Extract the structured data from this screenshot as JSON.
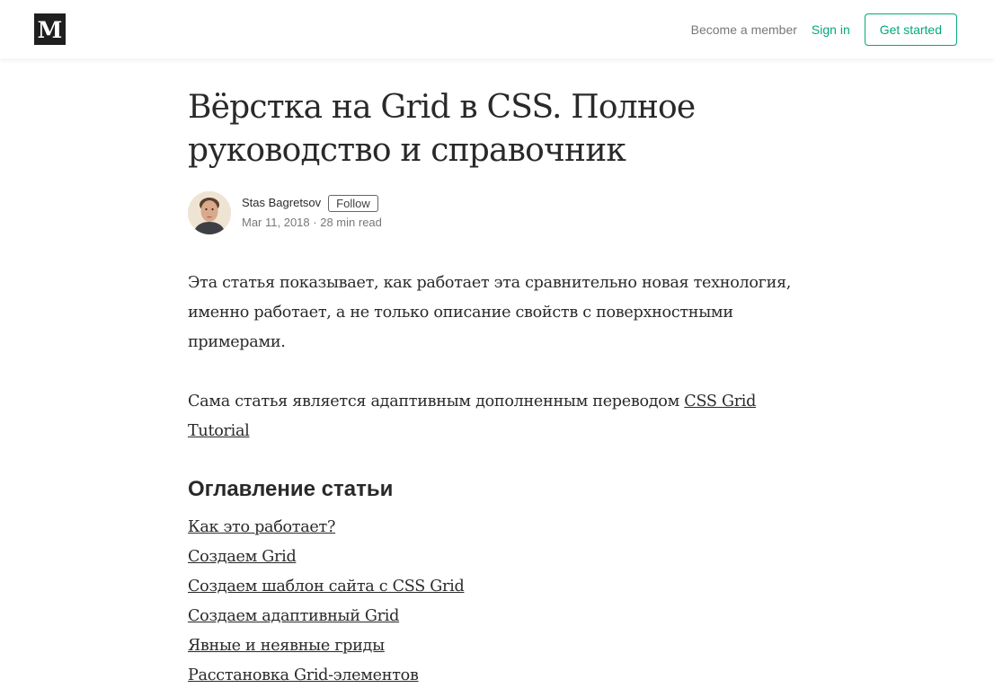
{
  "nav": {
    "logo_letter": "M",
    "logo_icon": "medium-logo-icon",
    "become_member": "Become a member",
    "sign_in": "Sign in",
    "get_started": "Get started",
    "accent_color": "#03a87c"
  },
  "article": {
    "title": "Вёрстка на Grid в CSS. Полное руководство и справочник",
    "author": {
      "name": "Stas Bagretsov",
      "follow_label": "Follow",
      "date": "Mar 11, 2018",
      "separator": "·",
      "read_time": "28 min read",
      "avatar_icon": "author-avatar"
    },
    "paragraphs": [
      {
        "text": "Эта статья показывает, как работает эта сравнительно новая технология, именно работает, а не только описание свойств с поверхностными примерами."
      },
      {
        "text_before_link": "Сама статья является адаптивным дополненным переводом ",
        "link_text": "CSS Grid Tutorial"
      }
    ],
    "toc_heading": "Оглавление статьи",
    "toc_items": [
      "Как это работает?",
      "Создаем Grid",
      "Создаем шаблон сайта с CSS Grid",
      "Создаем адаптивный Grid",
      "Явные и неявные гриды",
      "Расстановка Grid-элементов"
    ]
  }
}
